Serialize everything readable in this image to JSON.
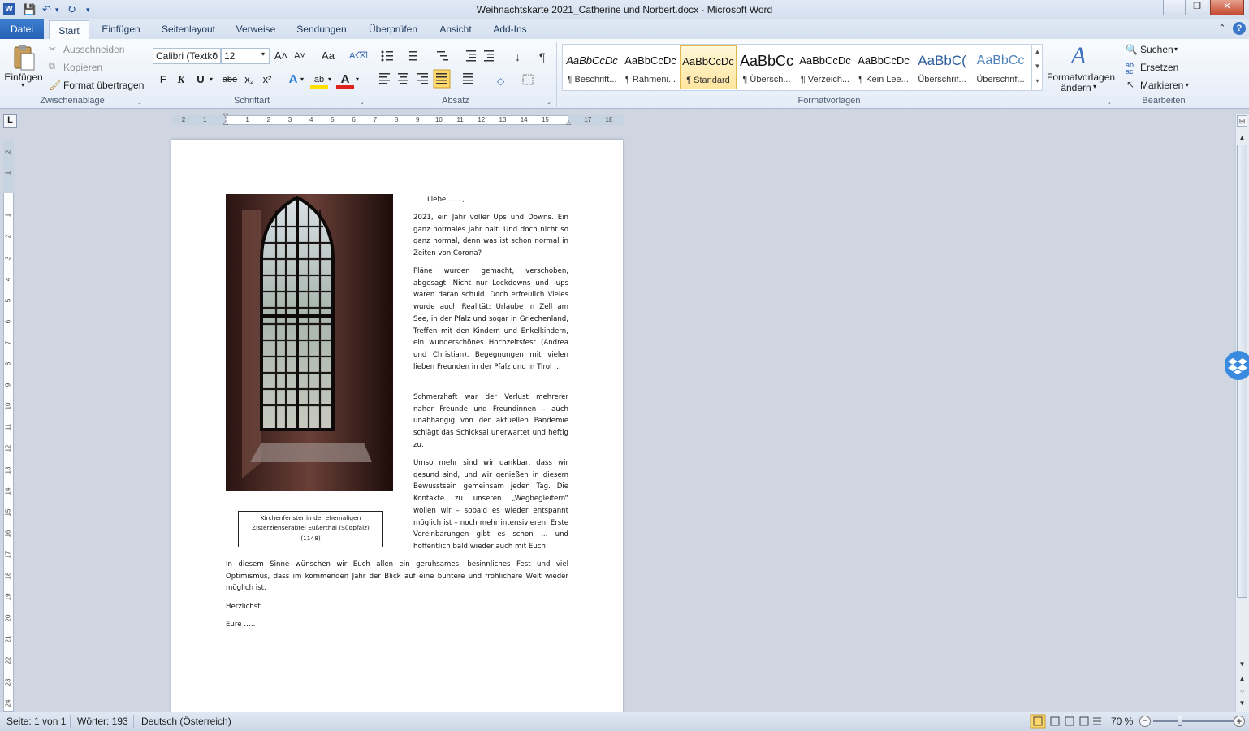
{
  "window": {
    "title": "Weihnachtskarte 2021_Catherine und Norbert.docx - Microsoft Word",
    "minimize": "─",
    "restore": "❐",
    "close": "✕"
  },
  "quick_access": {
    "word_icon": "W",
    "save": "💾",
    "undo": "↶",
    "redo": "↻",
    "more": "▾"
  },
  "tabs": [
    "Datei",
    "Start",
    "Einfügen",
    "Seitenlayout",
    "Verweise",
    "Sendungen",
    "Überprüfen",
    "Ansicht",
    "Add-Ins"
  ],
  "active_tab": "Start",
  "ribbon_right": {
    "collapse": "⌃",
    "help": "?"
  },
  "clipboard": {
    "label": "Zwischenablage",
    "paste": "Einfügen",
    "cut": "Ausschneiden",
    "copy": "Kopieren",
    "format_painter": "Format übertragen"
  },
  "font": {
    "label": "Schriftart",
    "family": "Calibri (Textkö",
    "size": "12",
    "grow": "A˄",
    "shrink": "A˅",
    "case": "Aa",
    "clear": "A⌫",
    "bold": "F",
    "italic": "K",
    "underline": "U",
    "strike": "abe",
    "subscript": "x₂",
    "superscript": "x²",
    "effects": "A",
    "highlight": "ab",
    "color": "A"
  },
  "paragraph": {
    "label": "Absatz"
  },
  "styles": {
    "label": "Formatvorlagen",
    "items": [
      {
        "sample": "AaBbCcDc",
        "name": "¶ Beschrift..."
      },
      {
        "sample": "AaBbCcDc",
        "name": "¶ Rahmeni..."
      },
      {
        "sample": "AaBbCcDc",
        "name": "¶ Standard"
      },
      {
        "sample": "AaBbCc",
        "name": "¶ Übersch..."
      },
      {
        "sample": "AaBbCcDc",
        "name": "¶ Verzeich..."
      },
      {
        "sample": "AaBbCcDc",
        "name": "¶ Kein Lee..."
      },
      {
        "sample": "AaBbC(",
        "name": "Überschrif..."
      },
      {
        "sample": "AaBbCc",
        "name": "Überschrif..."
      }
    ],
    "active_index": 2,
    "change_line1": "Formatvorlagen",
    "change_line2": "ändern"
  },
  "editing": {
    "label": "Bearbeiten",
    "find": "Suchen",
    "replace": "Ersetzen",
    "select": "Markieren"
  },
  "ruler": {
    "h_ticks": [
      "2",
      "1",
      "",
      "1",
      "2",
      "3",
      "4",
      "5",
      "6",
      "7",
      "8",
      "9",
      "10",
      "11",
      "12",
      "13",
      "14",
      "15",
      "",
      "17",
      "18"
    ],
    "v_ticks": [
      "2",
      "1",
      "",
      "1",
      "2",
      "3",
      "4",
      "5",
      "6",
      "7",
      "8",
      "9",
      "10",
      "11",
      "12",
      "13",
      "14",
      "15",
      "16",
      "17",
      "18",
      "19",
      "20",
      "21",
      "22",
      "23",
      "24"
    ],
    "corner": "L"
  },
  "document": {
    "greeting": "Liebe ……,",
    "paragraphs": [
      "2021, ein Jahr voller Ups und Downs. Ein ganz normales Jahr halt. Und doch nicht so ganz normal, denn was ist schon normal in Zeiten von Corona?",
      "Pläne wurden gemacht, verschoben, abgesagt. Nicht nur Lockdowns und -ups waren daran schuld. Doch erfreulich Vieles wurde auch Realität: Urlaube in Zell am See, in der Pfalz und sogar in Griechenland, Treffen mit den Kindern und Enkelkindern, ein wunderschönes Hochzeitsfest (Andrea und Christian), Begegnungen mit vielen lieben Freunden in der Pfalz und in Tirol …",
      "Schmerzhaft war der Verlust mehrerer naher Freunde und Freundinnen – auch unabhängig von der aktuellen Pandemie schlägt das Schicksal unerwartet und heftig zu.",
      "Umso mehr sind wir dankbar, dass wir gesund sind, und wir genießen in diesem Bewusstsein gemeinsam jeden Tag. Die Kontakte zu unseren „Wegbegleitern“ wollen wir – sobald es wieder entspannt möglich ist – noch mehr intensivieren. Erste Vereinbarungen gibt es schon … und hoffentlich bald wieder auch mit Euch!"
    ],
    "closing_paragraph": "In diesem Sinne wünschen wir Euch allen ein geruhsames, besinnliches Fest und viel Optimismus, dass im kommenden Jahr der Blick auf eine buntere und fröhlichere Welt wieder möglich ist.",
    "sign1": "Herzlichst",
    "sign2": "Eure …..",
    "caption_line1": "Kirchenfenster in der ehemaligen",
    "caption_line2": "Zisterzienserabtei Eußerthal (Südpfalz)",
    "caption_line3": "(1148)"
  },
  "status": {
    "page": "Seite: 1 von 1",
    "words": "Wörter: 193",
    "language": "Deutsch (Österreich)",
    "zoom": "70 %",
    "zoom_level_percent": 70
  },
  "colors": {
    "accent": "#2561b5",
    "ribbon": "#e4ecf7",
    "background": "#cfd6e1",
    "highlight": "#ffd86b"
  }
}
